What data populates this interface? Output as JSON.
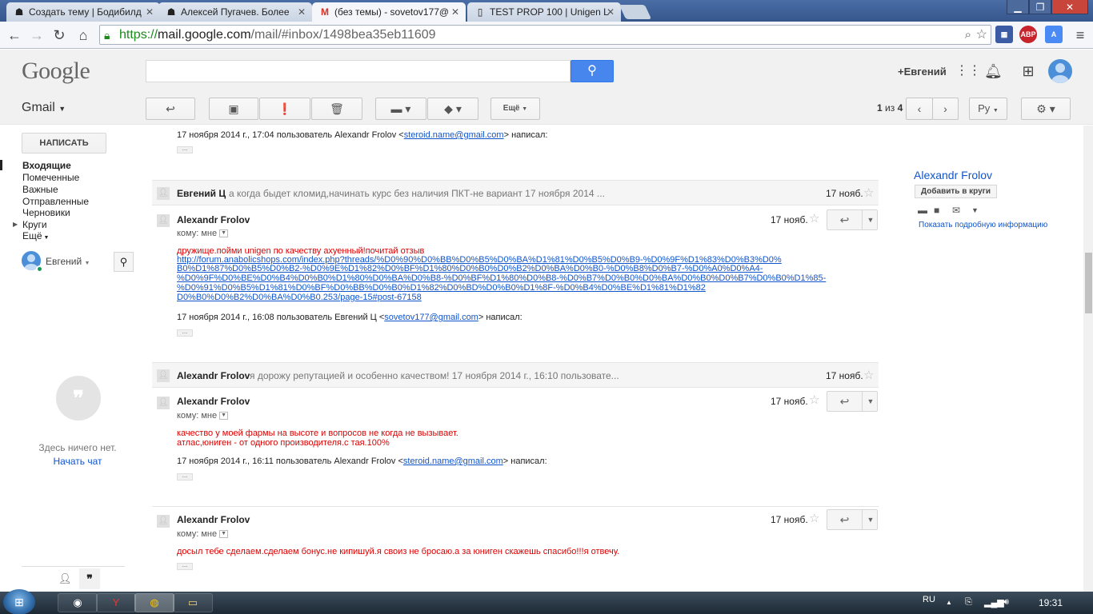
{
  "browser": {
    "tabs": [
      {
        "title": "Создать тему | Бодибилд",
        "icon": "forum-icon"
      },
      {
        "title": "Алексей Пугачев. Более",
        "icon": "forum-icon"
      },
      {
        "title": "(без темы) - sovetov177@",
        "icon": "gmail-icon",
        "active": true
      },
      {
        "title": "TEST PROP 100 | Unigen L",
        "icon": "page-icon"
      }
    ],
    "url_scheme": "https://",
    "url_host": "mail.google.com",
    "url_path": "/mail/#inbox/1498bea35eb11609",
    "ext_abp": "ABP"
  },
  "header": {
    "logo": "Google",
    "plus_user": "+Евгений"
  },
  "toolbar": {
    "gmail_label": "Gmail",
    "more_label": "Ещё",
    "pager_current": "1",
    "pager_of": "из",
    "pager_total": "4",
    "lang_label": "Ру"
  },
  "sidebar": {
    "compose_label": "НАПИСАТЬ",
    "items": [
      {
        "label": "Входящие",
        "name": "inbox"
      },
      {
        "label": "Помеченные",
        "name": "starred"
      },
      {
        "label": "Важные",
        "name": "important"
      },
      {
        "label": "Отправленные",
        "name": "sent"
      },
      {
        "label": "Черновики",
        "name": "drafts"
      },
      {
        "label": "Круги",
        "name": "circles"
      },
      {
        "label": "Ещё",
        "name": "more"
      }
    ],
    "user_name": "Евгений",
    "hangouts_empty": "Здесь ничего нет.",
    "start_chat": "Начать чат"
  },
  "thread": {
    "top_quote": {
      "prefix": "17 ноября 2014 г., 17:04 пользователь Alexandr Frolov <",
      "email": "steroid.name@gmail.com",
      "suffix": "> написал:"
    },
    "collapsed1": {
      "sender": "Евгений Ц",
      "snippet": "а когда быдет кломид,начинать курс без наличия ПКТ-не вариант 17 ноября 2014 ...",
      "date": "17 нояб."
    },
    "msg1": {
      "sender": "Alexandr Frolov",
      "date": "17 нояб.",
      "to": "кому: мне",
      "body_line": "дружище.пойми unigen по качеству ахуенный!почитай отзыв",
      "link_lines": [
        "http://forum.anabolicshops.com/index.php?threads/%D0%90%D0%BB%D0%B5%D0%BA%D1%81%D0%B5%D0%B9-%D0%9F%D1%83%D0%B3%D0%",
        "B0%D1%87%D0%B5%D0%B2-%D0%9E%D1%82%D0%BF%D1%80%D0%B0%D0%B2%D0%BA%D0%B0-%D0%B8%D0%B7-%D0%A0%D0%A4-",
        "%D0%9F%D0%BE%D0%B4%D0%B0%D1%80%D0%BA%D0%B8-%D0%BF%D1%80%D0%B8-%D0%B7%D0%B0%D0%BA%D0%B0%D0%B7%D0%B0%D1%85-",
        "%D0%91%D0%B5%D1%81%D0%BF%D0%BB%D0%B0%D1%82%D0%BD%D0%B0%D1%8F-%D0%B4%D0%BE%D1%81%D1%82",
        "D0%B0%D0%B2%D0%BA%D0%B0.253/page-15#post-67158"
      ],
      "quote_prefix": "17 ноября 2014 г., 16:08 пользователь Евгений Ц <",
      "quote_email": "sovetov177@gmail.com",
      "quote_suffix": "> написал:"
    },
    "collapsed2": {
      "sender": "Alexandr Frolov",
      "snippet": "я дорожу репутацией и особенно качеством! 17 ноября 2014 г., 16:10 пользовате...",
      "date": "17 нояб."
    },
    "msg2": {
      "sender": "Alexandr Frolov",
      "date": "17 нояб.",
      "to": "кому: мне",
      "body_lines": [
        "качество у моей фармы на высоте и вопросов не когда не вызывает.",
        "атлас,юниген - от одного производителя.с тая.100%"
      ],
      "quote_prefix": "17 ноября 2014 г., 16:11 пользователь Alexandr Frolov <",
      "quote_email": "steroid.name@gmail.com",
      "quote_suffix": "> написал:"
    },
    "msg3": {
      "sender": "Alexandr Frolov",
      "date": "17 нояб.",
      "to": "кому: мне",
      "body_line": "досыл тебе сделаем.сделаем бонус.не кипишуй.я своиз не бросаю.а за юниген скажешь спасибо!!!я отвечу."
    }
  },
  "contact": {
    "name": "Alexandr Frolov",
    "add_to_circles": "Добавить в круги",
    "more_info": "Показать подробную информацию"
  },
  "taskbar": {
    "lang": "RU",
    "time": "19:31"
  },
  "colors": {
    "accent_blue": "#4787ed",
    "link": "#1155cc",
    "body_red": "#dd0000"
  }
}
